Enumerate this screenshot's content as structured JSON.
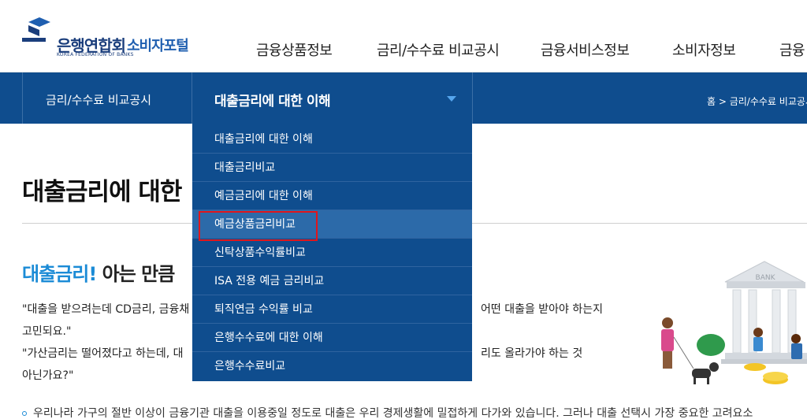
{
  "header": {
    "logo_main": "은행연합회",
    "logo_sub": "소비자포털",
    "logo_english": "KOREA FEDERATION OF BANKS",
    "nav": [
      "금융상품정보",
      "금리/수수료 비교공시",
      "금융서비스정보",
      "소비자정보",
      "금융"
    ]
  },
  "subnav": {
    "section": "금리/수수료 비교공시",
    "current": "대출금리에 대한 이해",
    "breadcrumb": "홈 > 금리/수수료 비교공시"
  },
  "dropdown": {
    "items": [
      "대출금리에 대한 이해",
      "대출금리비교",
      "예금금리에 대한 이해",
      "예금상품금리비교",
      "신탁상품수익률비교",
      "ISA 전용 예금 금리비교",
      "퇴직연금 수익률 비교",
      "은행수수료에 대한 이해",
      "은행수수료비교"
    ],
    "highlighted_index": 3
  },
  "content": {
    "page_title": "대출금리에 대한",
    "section_title_blue": "대출금리!",
    "section_title_rest": " 아는 만큼",
    "para1_left": "\"대출을 받으려는데 CD금리, 금융채",
    "para1_right": "어떤 대출을 받아야 하는지",
    "para1_line2": "고민되요.\"",
    "para2_left": "\"가산금리는 떨어졌다고 하는데, 대",
    "para2_right": "리도 올라가야 하는 것",
    "para2_line2": "아닌가요?\"",
    "bullet": "우리나라 가구의 절반 이상이 금융기관 대출을 이용중일 정도로 대출은 우리 경제생활에 밀접하게 다가와 있습니다. 그러나 대출 선택시 가장 중요한 고려요소",
    "bank_sign": "BANK"
  },
  "colors": {
    "nav_blue": "#0f4d8e",
    "accent_blue": "#1b8bd6",
    "highlight_red": "#e0161c"
  }
}
